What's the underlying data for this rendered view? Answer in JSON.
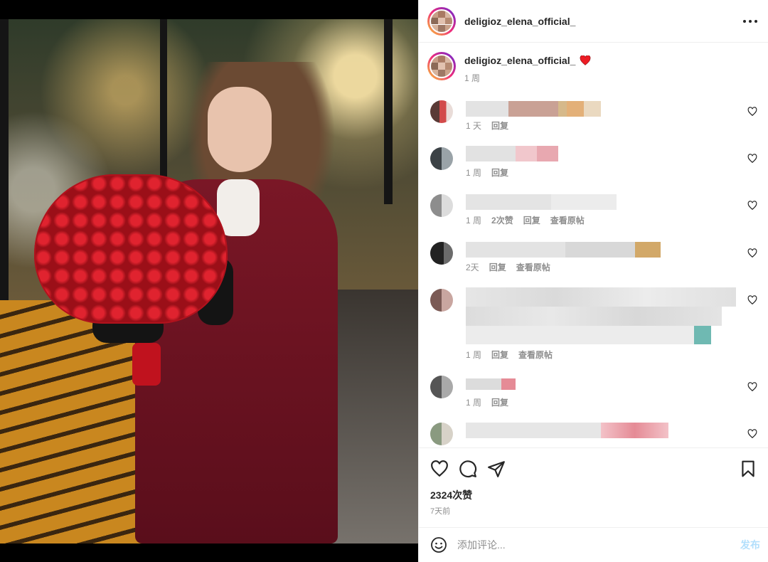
{
  "post": {
    "author": "deligioz_elena_official_",
    "likes_text": "2324次赞",
    "time_text": "7天前"
  },
  "caption": {
    "username": "deligioz_elena_official_",
    "emoji": "heart",
    "time": "1 周"
  },
  "comments": [
    {
      "time": "1 天",
      "reply": "回复",
      "likes": "",
      "view_original": ""
    },
    {
      "time": "1 周",
      "reply": "回复",
      "likes": "",
      "view_original": ""
    },
    {
      "time": "1 周",
      "reply": "回复",
      "likes": "2次赞",
      "view_original": "查看原帖"
    },
    {
      "time": "2天",
      "reply": "回复",
      "likes": "",
      "view_original": "查看原帖"
    },
    {
      "time": "1 周",
      "reply": "回复",
      "likes": "",
      "view_original": "查看原帖"
    },
    {
      "time": "1 周",
      "reply": "回复",
      "likes": "",
      "view_original": ""
    },
    {
      "time": "",
      "reply": "",
      "likes": "",
      "view_original": ""
    }
  ],
  "comment_input": {
    "placeholder": "添加评论...",
    "post_label": "发布"
  },
  "colors": {
    "accent_blue_disabled": "#b2dffc",
    "text_primary": "#262626",
    "text_secondary": "#8e8e8e",
    "heart_red": "#ed1c24"
  },
  "icons": {
    "more": "more-icon",
    "like": "heart-outline-icon",
    "comment": "comment-icon",
    "share": "paper-plane-icon",
    "save": "bookmark-icon",
    "emoji": "smiley-icon"
  }
}
